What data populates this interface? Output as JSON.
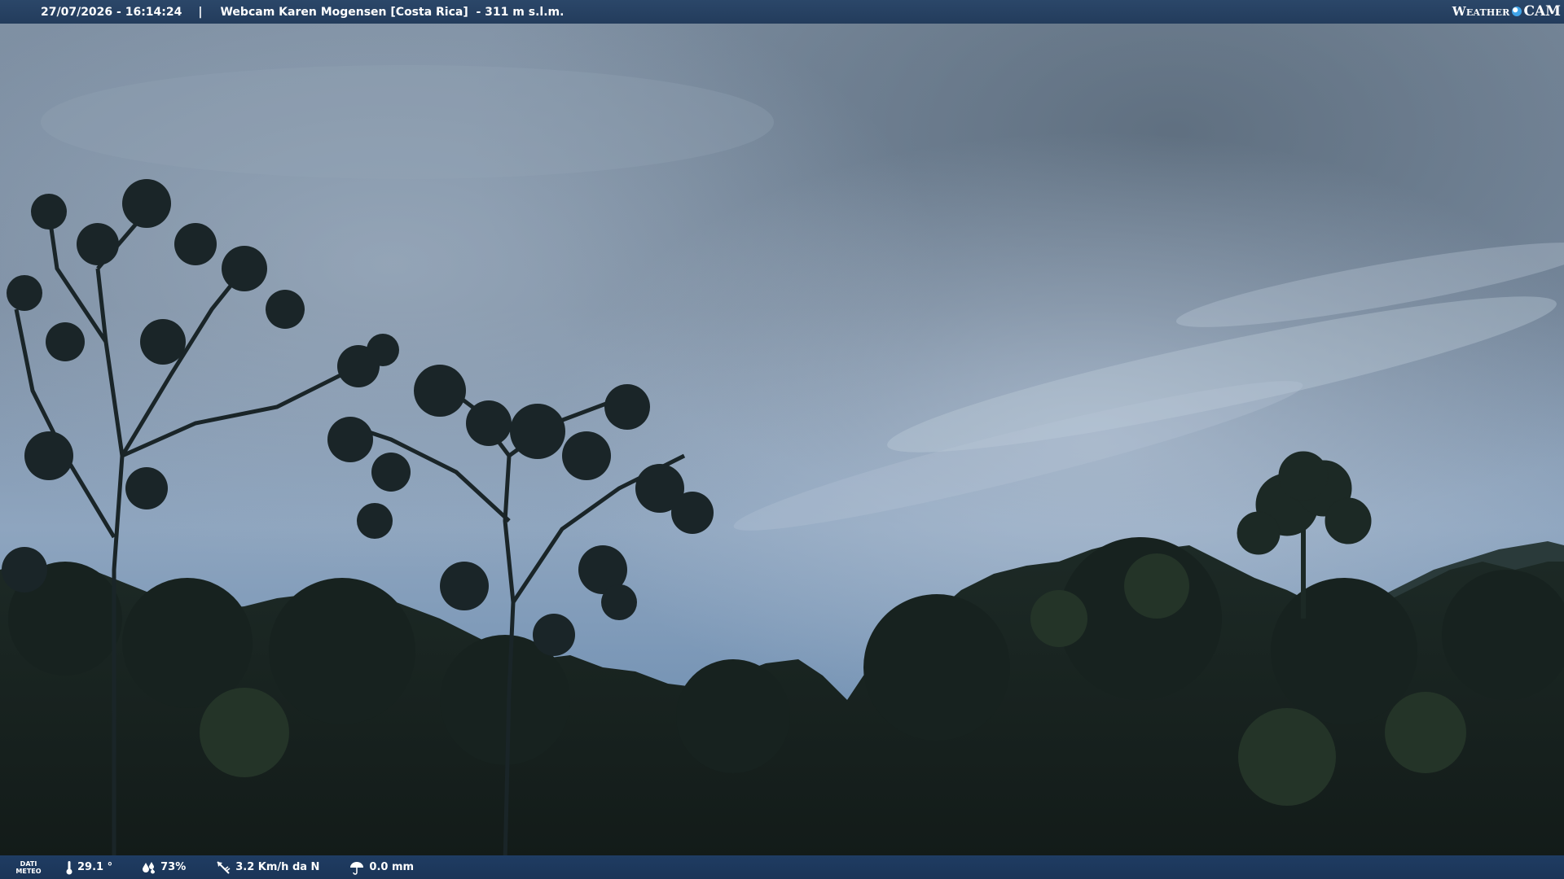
{
  "overlay": {
    "timestamp": "27/07/2026 - 16:14:24",
    "separator": "|",
    "location": "Webcam Karen Mogensen [Costa Rica]  - 311 m s.l.m.",
    "brand_weather": "Weather",
    "brand_cam": "CAM"
  },
  "weather": {
    "label_line1": "DATI",
    "label_line2": "METEO",
    "temperature": "29.1 °",
    "humidity": "73%",
    "wind": "3.2 Km/h da N",
    "rain": "0.0 mm"
  },
  "colors": {
    "bar": "#233c5c",
    "brand_accent": "#3fa4e8"
  }
}
